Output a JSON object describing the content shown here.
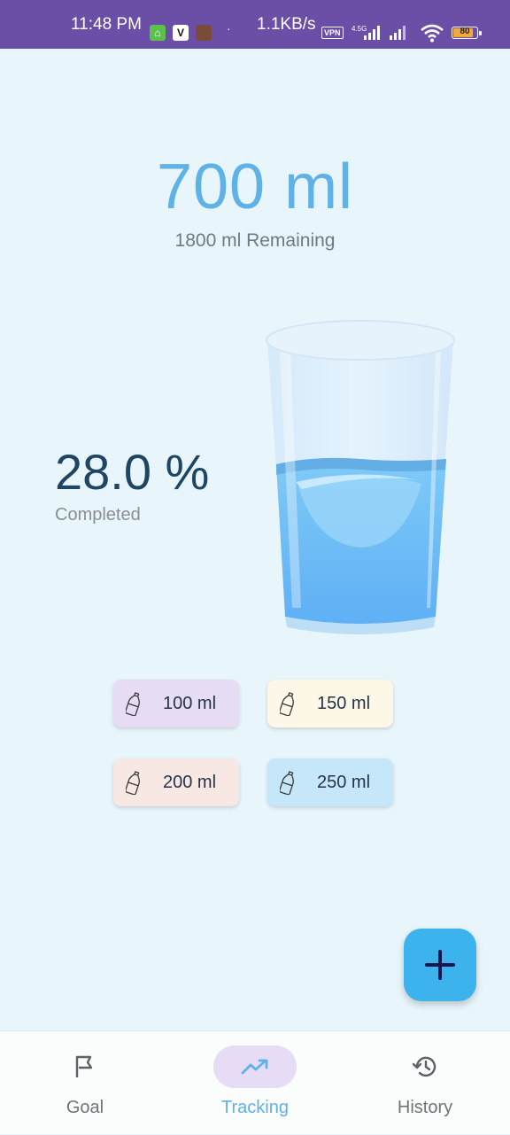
{
  "status_bar": {
    "time": "11:48 PM",
    "dot": "·",
    "speed": "1.1KB/s",
    "vpn": "VPN",
    "network": "4.5G",
    "battery": "80"
  },
  "main": {
    "total": "700 ml",
    "remaining": "1800 ml Remaining",
    "percent": "28.0 %",
    "completed_label": "Completed",
    "fill_fraction": 0.28
  },
  "quick_add": [
    {
      "label": "100 ml",
      "color": "#e6dcf4"
    },
    {
      "label": "150 ml",
      "color": "#fdf7e8"
    },
    {
      "label": "200 ml",
      "color": "#f7e8e4"
    },
    {
      "label": "250 ml",
      "color": "#c6e6fa"
    }
  ],
  "fab": {
    "icon": "plus-icon"
  },
  "bottom_nav": {
    "items": [
      {
        "label": "Goal",
        "icon": "flag-icon"
      },
      {
        "label": "Tracking",
        "icon": "trending-up-icon",
        "active": true
      },
      {
        "label": "History",
        "icon": "history-icon"
      }
    ]
  },
  "colors": {
    "status_bar": "#6b4fa6",
    "background": "#e8f5fb",
    "accent": "#5fb2e8",
    "fab": "#3db3ed",
    "percent_text": "#1f4565"
  }
}
